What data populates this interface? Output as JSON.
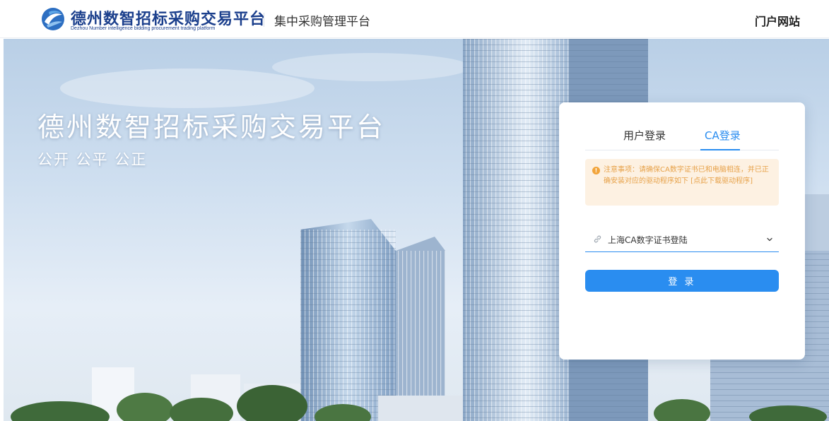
{
  "header": {
    "logo_title": "德州数智招标采购交易平台",
    "logo_subtitle": "Dezhou Number intelligence bidding procurement trading platform",
    "system_name": "集中采购管理平台",
    "portal_link": "门户网站"
  },
  "hero": {
    "title": "德州数智招标采购交易平台",
    "slogan": "公开  公平  公正"
  },
  "login": {
    "tabs": [
      {
        "label": "用户登录",
        "active": false
      },
      {
        "label": "CA登录",
        "active": true
      }
    ],
    "notice": "注意事项：请确保CA数字证书已和电脑相连，并已正确安装对应的驱动程序如下 [点此下载驱动程序]",
    "certificate_select": {
      "value": "上海CA数字证书登陆",
      "icon": "link-icon"
    },
    "submit_label": "登 录"
  },
  "colors": {
    "accent": "#2a8df0",
    "brand": "#1b3f8c",
    "notice_bg": "#fdf1e2",
    "notice_text": "#e7a24a"
  }
}
